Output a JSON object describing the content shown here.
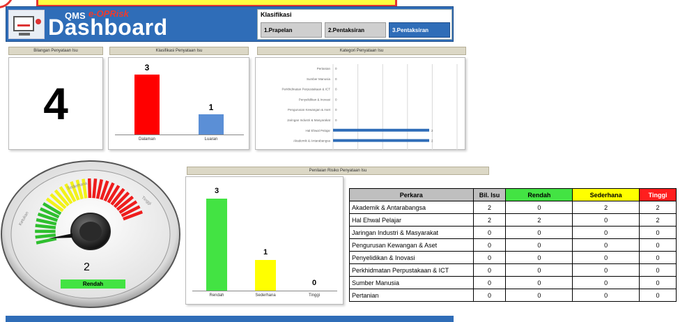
{
  "header": {
    "brand_small": "QMS",
    "brand_accent": "e-OPRisk",
    "brand_title": "Dashboard",
    "klasifikasi_title": "Klasifikasi",
    "tabs": [
      {
        "label": "1.Prapelan"
      },
      {
        "label": "2.Pentaksiran"
      },
      {
        "label": "3.Pentaksiran"
      }
    ]
  },
  "panels": {
    "count_title": "Bilangan Penyataan Isu",
    "count_value": "4",
    "klas_title": "Klasifikasi Penyataan Isu",
    "kategori_title": "Kategori Penyataan Isu",
    "penilaian_title": "Penilaian Risiko Penyataan Isu"
  },
  "chart_data": [
    {
      "type": "bar",
      "title": "Klasifikasi Penyataan Isu",
      "categories": [
        "Dalaman",
        "Luaran"
      ],
      "values": [
        3,
        1
      ],
      "colors": [
        "#ff0000",
        "#5b8fd6"
      ]
    },
    {
      "type": "bar",
      "orientation": "horizontal",
      "title": "Kategori Penyataan Isu",
      "categories": [
        "Pertanian",
        "Sumber Manusia",
        "Perkhidmatan Perpustakaan & ICT",
        "Penyelidikan & Inovasi",
        "Pengurusan Kewangan & Aset",
        "Jaringan Industri & Masyarakat",
        "Hal Ehwal Pelajar",
        "Akademik & Antarabangsa"
      ],
      "values": [
        0,
        0,
        0,
        0,
        0,
        0,
        2,
        2
      ],
      "color": "#2f6db8"
    },
    {
      "type": "bar",
      "title": "Penilaian Risiko Penyataan Isu",
      "categories": [
        "Rendah",
        "Sederhana",
        "Tinggi"
      ],
      "values": [
        3,
        1,
        0
      ],
      "colors": [
        "#43e343",
        "#ffff00",
        "#ff0000"
      ]
    }
  ],
  "gauge": {
    "value": "2",
    "status": "Rendah",
    "label_left": "Ketukan",
    "label_mid": "Sederhana",
    "label_right": "Tinggi"
  },
  "risk_table": {
    "headers": [
      "Perkara",
      "Bil. Isu",
      "Rendah",
      "Sederhana",
      "Tinggi"
    ],
    "rows": [
      [
        "Akademik & Antarabangsa",
        "2",
        "0",
        "2",
        "2"
      ],
      [
        "Hal Ehwal Pelajar",
        "2",
        "2",
        "0",
        "2"
      ],
      [
        "Jaringan Industri & Masyarakat",
        "0",
        "0",
        "0",
        "0"
      ],
      [
        "Pengurusan Kewangan & Aset",
        "0",
        "0",
        "0",
        "0"
      ],
      [
        "Penyelidikan & Inovasi",
        "0",
        "0",
        "0",
        "0"
      ],
      [
        "Perkhidmatan Perpustakaan & ICT",
        "0",
        "0",
        "0",
        "0"
      ],
      [
        "Sumber Manusia",
        "0",
        "0",
        "0",
        "0"
      ],
      [
        "Pertanian",
        "0",
        "0",
        "0",
        "0"
      ]
    ]
  }
}
